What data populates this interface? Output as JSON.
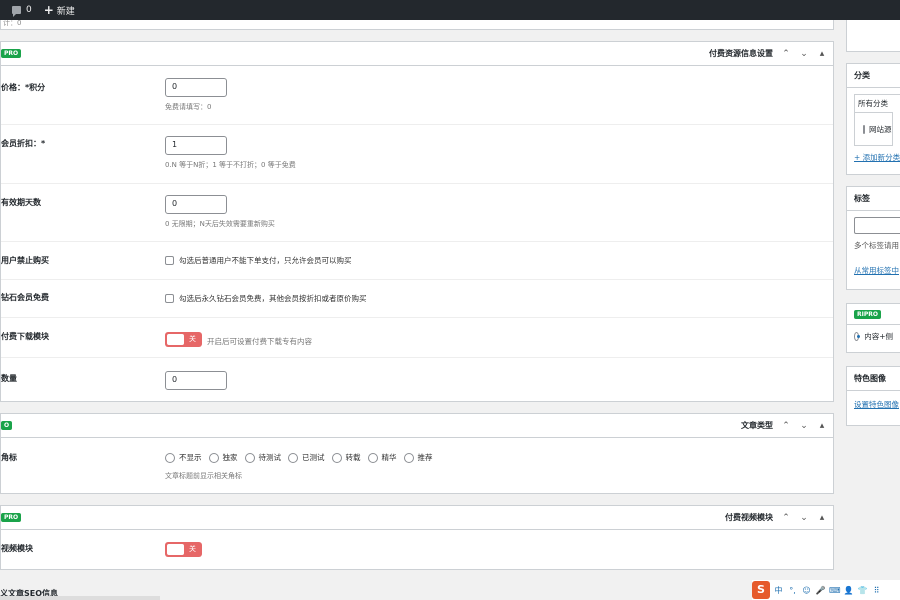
{
  "adminbar": {
    "item1_label": "",
    "comments_count": "0",
    "new_label": "新建"
  },
  "top_fragment": "计：0",
  "box1": {
    "badge": "PRO",
    "title": "付费资源信息设置",
    "rows": {
      "price": {
        "label": "价格：*积分",
        "value": "0",
        "hint": "免费请填写：0"
      },
      "discount": {
        "label": "会员折扣：*",
        "value": "1",
        "hint": "0.N 等于N折；1 等于不打折；0 等于免费"
      },
      "days": {
        "label": "有效期天数",
        "value": "0",
        "hint": "0 无限期；N天后失效需要重新购买"
      },
      "ban": {
        "label": "用户禁止购买",
        "text": "勾选后普通用户不能下单支付，只允许会员可以购买"
      },
      "diamond": {
        "label": "钻石会员免费",
        "text": "勾选后永久钻石会员免费，其他会员按折扣或者原价购买"
      },
      "download": {
        "label": "付费下载模块",
        "toggle": "关",
        "text": "开启后可设置付费下载专有内容"
      },
      "count": {
        "label": "数量",
        "value": "0"
      }
    }
  },
  "box2": {
    "badge": "O",
    "title": "文章类型",
    "row_label": "角标",
    "options": [
      "不显示",
      "独家",
      "待测试",
      "已测试",
      "转载",
      "精华",
      "推荐"
    ],
    "hint": "文章标题前显示相关角标"
  },
  "box3": {
    "badge": "PRO",
    "title": "付费视频模块",
    "row_label": "视频模块",
    "toggle": "关"
  },
  "bottom_text": "义文章SEO信息",
  "sidebar": {
    "category": {
      "title": "分类",
      "tab": "所有分类",
      "item": "网站源",
      "link": "+ 添加新分类"
    },
    "tags": {
      "title": "标签",
      "hint": "多个标签请用",
      "link": "从常用标签中"
    },
    "ripro": {
      "badge": "RIPRO",
      "option": "内容+侧"
    },
    "featured": {
      "title": "特色图像",
      "link": "设置特色图像"
    }
  },
  "tray": {
    "sogou": "S",
    "items": [
      "中",
      "°,",
      "☺",
      "🎤",
      "⌨",
      "👤",
      "👕",
      "⠿"
    ]
  }
}
